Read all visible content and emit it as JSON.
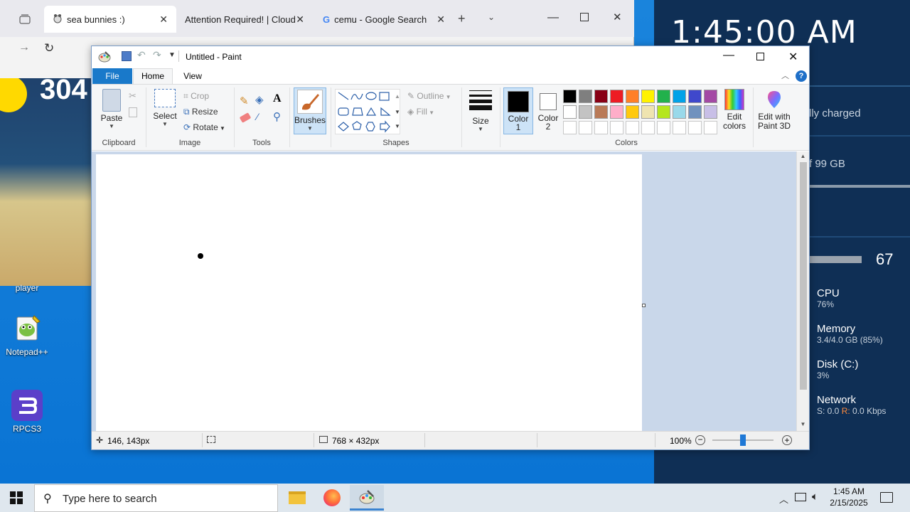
{
  "desktop": {
    "panel": {
      "clock": "1:45:00 AM",
      "battery_text": "lly charged",
      "storage_text": "f 99 GB",
      "volume_value": "67",
      "perf": [
        {
          "title": "CPU",
          "detail": "76%"
        },
        {
          "title": "Memory",
          "detail": "3.4/4.0 GB (85%)"
        },
        {
          "title": "Disk (C:)",
          "detail": "3%"
        },
        {
          "title": "Network",
          "detail_s": "S: 0.0",
          "detail_r_label": "R:",
          "detail_r": "0.0 Kbps"
        }
      ]
    },
    "icons": [
      {
        "label": "player"
      },
      {
        "label": "Notepad++"
      },
      {
        "label": "RPCS3"
      }
    ],
    "weather": {
      "temp": "304"
    }
  },
  "browser": {
    "tabs": [
      {
        "label": "sea bunnies :)",
        "icon": "sea-bunny-favicon"
      },
      {
        "label": "Attention Required! | Cloudfla",
        "icon": "none"
      },
      {
        "label": "cemu - Google Search",
        "icon": "google-icon"
      }
    ]
  },
  "paint": {
    "title": "Untitled - Paint",
    "ribbon_tabs": [
      "File",
      "Home",
      "View"
    ],
    "clipboard": {
      "paste": "Paste",
      "group": "Clipboard"
    },
    "image": {
      "select": "Select",
      "crop": "Crop",
      "resize": "Resize",
      "rotate": "Rotate",
      "group": "Image"
    },
    "tools": {
      "group": "Tools"
    },
    "brushes": {
      "label": "Brushes"
    },
    "shapes": {
      "outline": "Outline",
      "fill": "Fill",
      "group": "Shapes"
    },
    "size": {
      "label": "Size"
    },
    "colors": {
      "color1_label": "Color",
      "color1_num": "1",
      "color2_label": "Color",
      "color2_num": "2",
      "edit_label_1": "Edit",
      "edit_label_2": "colors",
      "paint3d_label_1": "Edit with",
      "paint3d_label_2": "Paint 3D",
      "group": "Colors",
      "color1": "#000000",
      "color2": "#ffffff",
      "palette_row1": [
        "#000000",
        "#7f7f7f",
        "#880015",
        "#ed1c24",
        "#ff7f27",
        "#fff200",
        "#22b14c",
        "#00a2e8",
        "#3f48cc",
        "#a349a4"
      ],
      "palette_row2": [
        "#ffffff",
        "#c3c3c3",
        "#b97a57",
        "#ffaec9",
        "#ffc90e",
        "#efe4b0",
        "#b5e61d",
        "#99d9ea",
        "#7092be",
        "#c8bfe7"
      ]
    },
    "status": {
      "cursor_pos": "146, 143px",
      "canvas_size": "768 × 432px",
      "zoom": "100%"
    }
  },
  "taskbar": {
    "search_placeholder": "Type here to search",
    "time": "1:45 AM",
    "date": "2/15/2025"
  }
}
